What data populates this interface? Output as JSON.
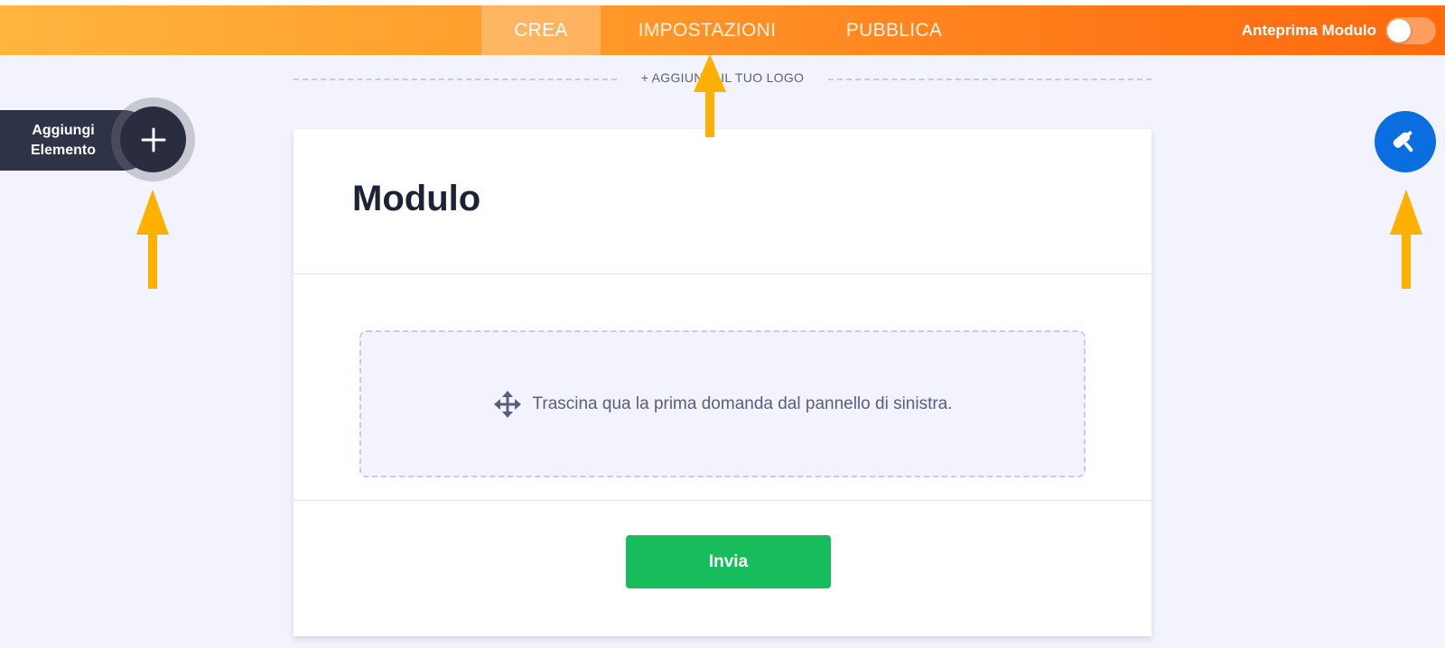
{
  "navbar": {
    "tabs": [
      {
        "label": "CREA",
        "active": true
      },
      {
        "label": "IMPOSTAZIONI",
        "active": false
      },
      {
        "label": "PUBBLICA",
        "active": false
      }
    ],
    "preview_label": "Anteprima Modulo",
    "preview_toggle_on": false
  },
  "logo": {
    "add_label": "+ AGGIUNGI IL TUO LOGO"
  },
  "sidebar": {
    "add_element_label_line1": "Aggiungi",
    "add_element_label_line2": "Elemento"
  },
  "form": {
    "title": "Modulo",
    "drop_hint": "Trascina qua la prima domanda dal pannello di sinistra.",
    "submit_label": "Invia"
  },
  "colors": {
    "nav_gradient_start": "#ffb53f",
    "nav_gradient_end": "#ff6a0c",
    "submit_green": "#18bd5b",
    "designer_blue": "#0b6ee0",
    "annotation_arrow": "#ffb000",
    "page_background": "#f3f3fe"
  },
  "icons": {
    "add": "plus-icon",
    "drop": "move-arrows-icon",
    "designer": "paint-roller-icon",
    "annotation": "up-arrow-icon"
  }
}
